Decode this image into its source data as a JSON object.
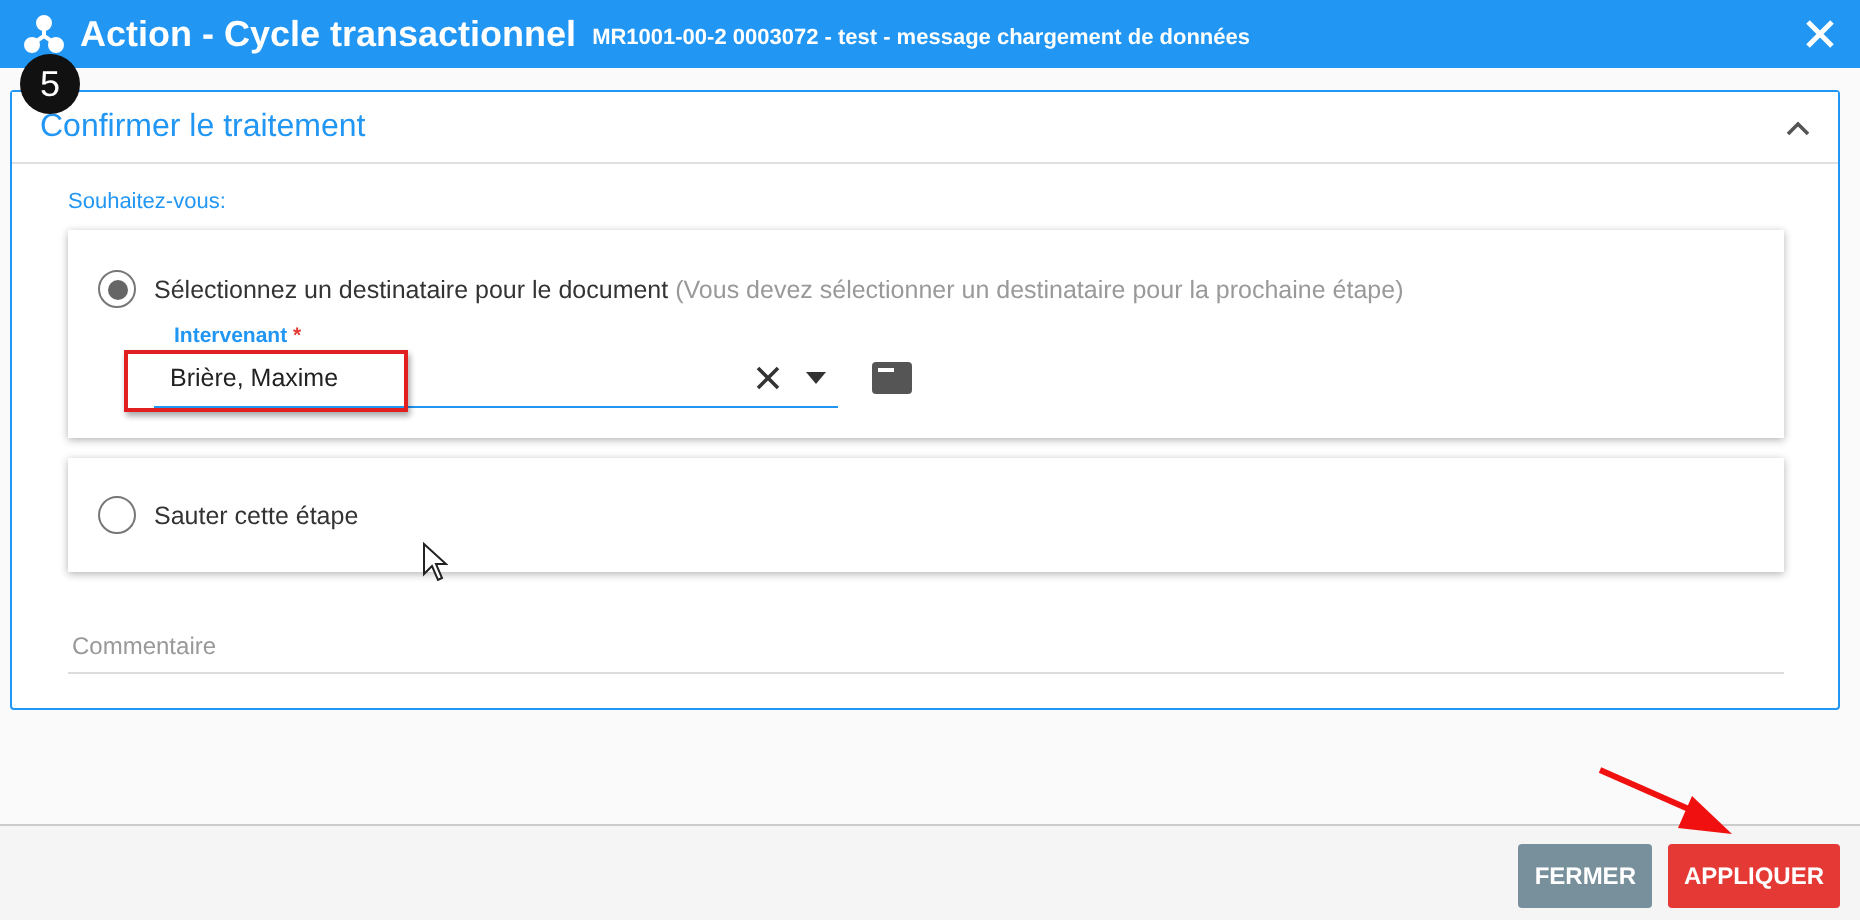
{
  "window": {
    "title": "Action - Cycle transactionnel",
    "subtitle": "MR1001-00-2 0003072 - test - message chargement de données"
  },
  "step_badge": "5",
  "section": {
    "title": "Confirmer le traitement",
    "expanded": true
  },
  "question": "Souhaitez-vous:",
  "options": [
    {
      "kind": "recipient",
      "label": "Sélectionnez un destinataire pour le document",
      "hint": "(Vous devez sélectionner un destinataire pour la prochaine étape)",
      "selected": true,
      "field": {
        "label": "Intervenant",
        "required_mark": "*",
        "value": "Brière, Maxime"
      }
    },
    {
      "kind": "plain",
      "label": "Sauter cette étape",
      "selected": false
    }
  ],
  "comment": {
    "placeholder": "Commentaire"
  },
  "buttons": [
    {
      "label": "FERMER",
      "kind": "secondary"
    },
    {
      "label": "APPLIQUER",
      "kind": "primary"
    }
  ]
}
